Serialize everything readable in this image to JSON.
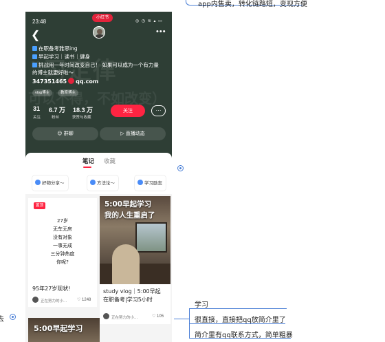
{
  "mindmap": {
    "top_text": "app内售卖，转化链路短，变现方便",
    "left_stub": "去",
    "nodes": [
      "学习",
      "很直接，直接把qq放简介里了",
      "简介里有qq联系方式，简单粗暴"
    ]
  },
  "phone": {
    "status_bar": {
      "time": "23:48",
      "app_badge": "小红书",
      "icons": "◎ ◷ ≋ ▴ ▭"
    },
    "profile": {
      "bio_lines": [
        "在职备考雅思ing",
        "早起学习｜读书｜健身",
        "挑战用一年时间改变自己！ 如果可以成为一个有力量",
        "的博主就更好啦～"
      ],
      "qq_prefix": "347351465",
      "qq_suffix": "qq.com",
      "tags": [
        "vlog博主",
        "教育博主"
      ],
      "watermark_1": "\"习定律\"",
      "watermark_2": "可以不得，不如改变）",
      "stats": [
        {
          "value": "31",
          "label": "关注"
        },
        {
          "value": "6.7 万",
          "label": "粉丝"
        },
        {
          "value": "18.3 万",
          "label": "获赞与收藏"
        }
      ],
      "follow_label": "关注",
      "chat_icon": "···",
      "group_chat_label": "群聊",
      "live_label": "直播动态"
    },
    "tabs": [
      "笔记",
      "收藏"
    ],
    "collections": [
      "好物分享～",
      "方法论～",
      "学习励志"
    ],
    "cards": [
      {
        "badge": "置顶",
        "poem": [
          "27岁",
          "无车无房",
          "没有对象",
          "一事无成",
          "三分钟热度",
          "你呢?"
        ],
        "title": "95年27岁现状!",
        "author": "正在努力的小...",
        "likes": "1248"
      },
      {
        "cover_line1": "5:00早起学习",
        "cover_line2": "我的人生重启了",
        "title_line1": "study vlog｜5:00早起",
        "title_line2": "在职备考|学习5小时",
        "author": "正在努力的小...",
        "likes": "105"
      }
    ],
    "bottom_cover_text": "5:00早起学习"
  }
}
